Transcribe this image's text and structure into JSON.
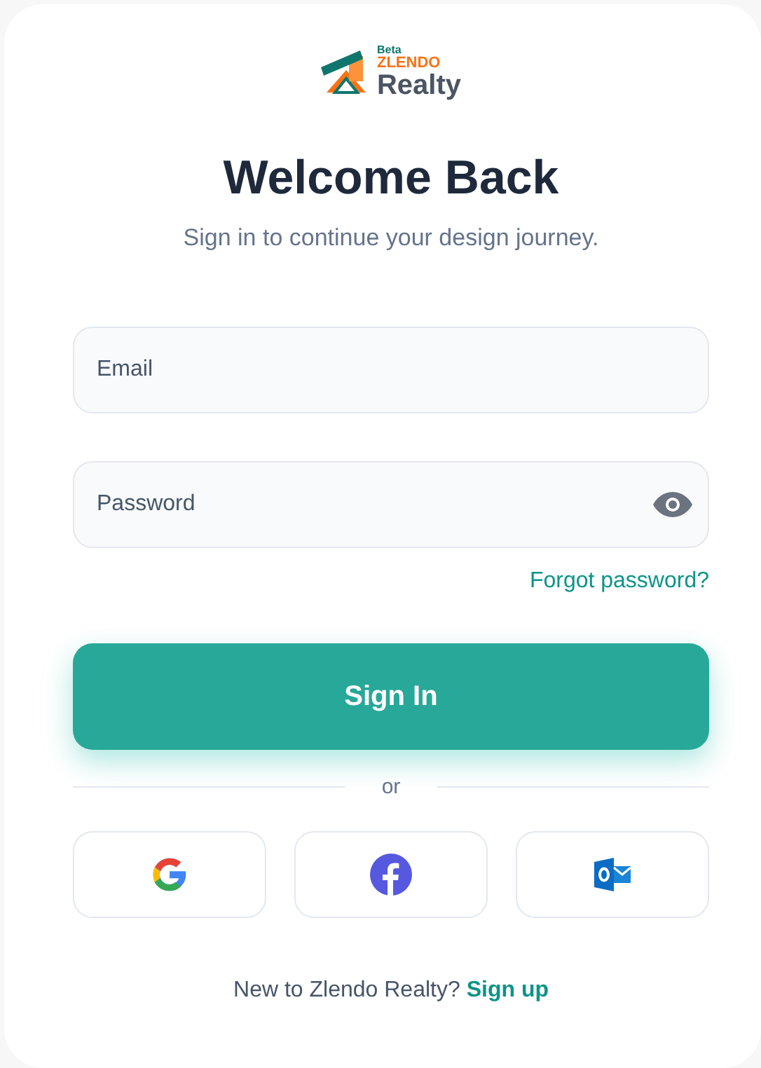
{
  "logo": {
    "badge": "Beta",
    "top": "ZLENDO",
    "bottom": "Realty"
  },
  "title": "Welcome Back",
  "subtitle": "Sign in to continue your design journey.",
  "fields": [
    {
      "kind": "text",
      "placeholder": "Email"
    },
    {
      "kind": "password",
      "placeholder": "Password"
    }
  ],
  "forgot_link": "Forgot password?",
  "submit": "Sign In",
  "divider": "or",
  "social": [
    {
      "kind": "google"
    },
    {
      "kind": "facebook"
    },
    {
      "kind": "outlook"
    }
  ],
  "footer": {
    "text": "New to Zlendo Realty?",
    "link": "Sign up"
  }
}
